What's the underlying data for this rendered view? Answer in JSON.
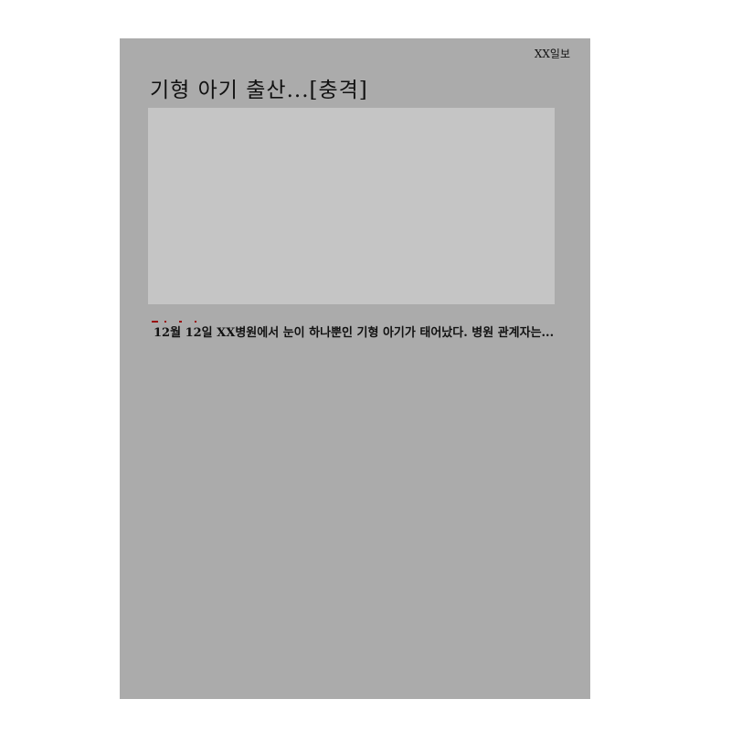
{
  "newspaper": {
    "publisher": "XX일보",
    "headline": "기형 아기 출산...[충격]",
    "body": "12월 12일 XX병원에서 눈이 하나뿐인 기형 아기가 태어났다. 병원 관계자는...",
    "colors": {
      "page_background": "#ababab",
      "photo_placeholder": "#c5c5c5",
      "accent_marks": "#9a1010"
    }
  }
}
